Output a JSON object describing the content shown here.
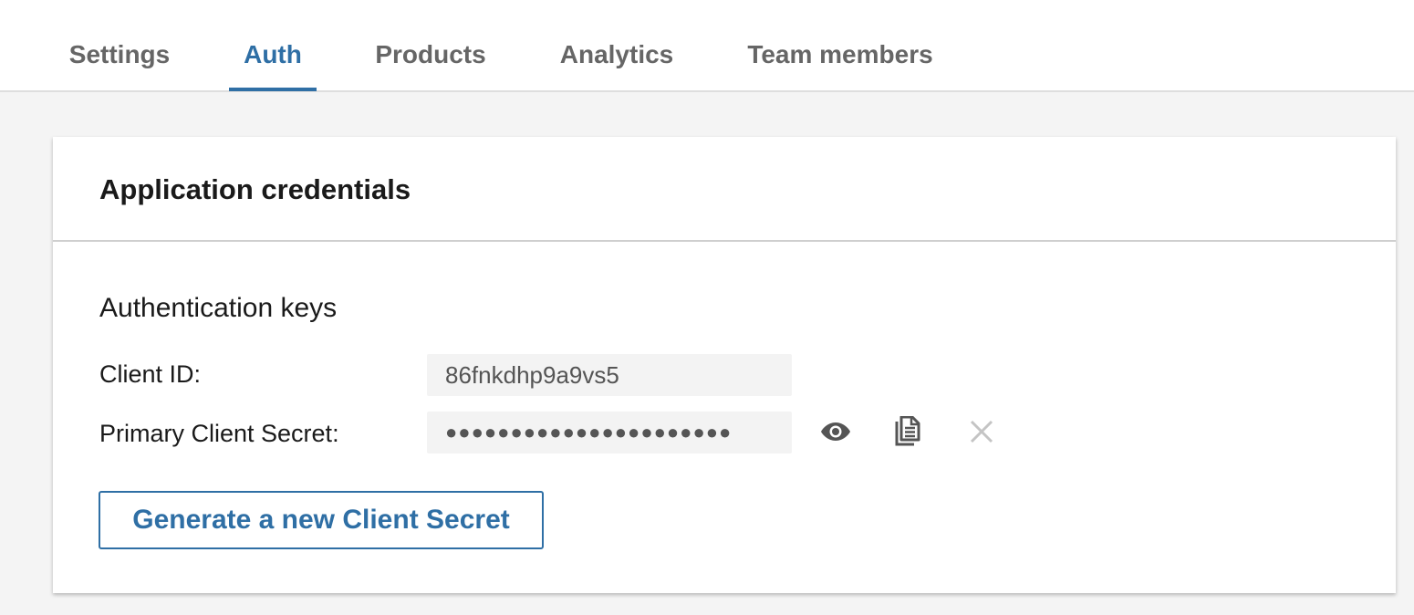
{
  "tabs": [
    {
      "label": "Settings",
      "active": false
    },
    {
      "label": "Auth",
      "active": true
    },
    {
      "label": "Products",
      "active": false
    },
    {
      "label": "Analytics",
      "active": false
    },
    {
      "label": "Team members",
      "active": false
    }
  ],
  "card": {
    "title": "Application credentials",
    "section_title": "Authentication keys",
    "client_id": {
      "label": "Client ID:",
      "value": "86fnkdhp9a9vs5"
    },
    "client_secret": {
      "label": "Primary Client Secret:",
      "value": "●●●●●●●●●●●●●●●●●●●●●●"
    },
    "icons": [
      "eye-icon",
      "copy-icon",
      "close-icon"
    ],
    "generate_button_label": "Generate a new Client Secret"
  },
  "colors": {
    "accent": "#2f6fa5",
    "tab_inactive": "#666666",
    "page_background": "#f4f4f4",
    "field_background": "#f3f3f3",
    "icon_dark": "#555555",
    "icon_disabled": "#c4c4c4"
  }
}
